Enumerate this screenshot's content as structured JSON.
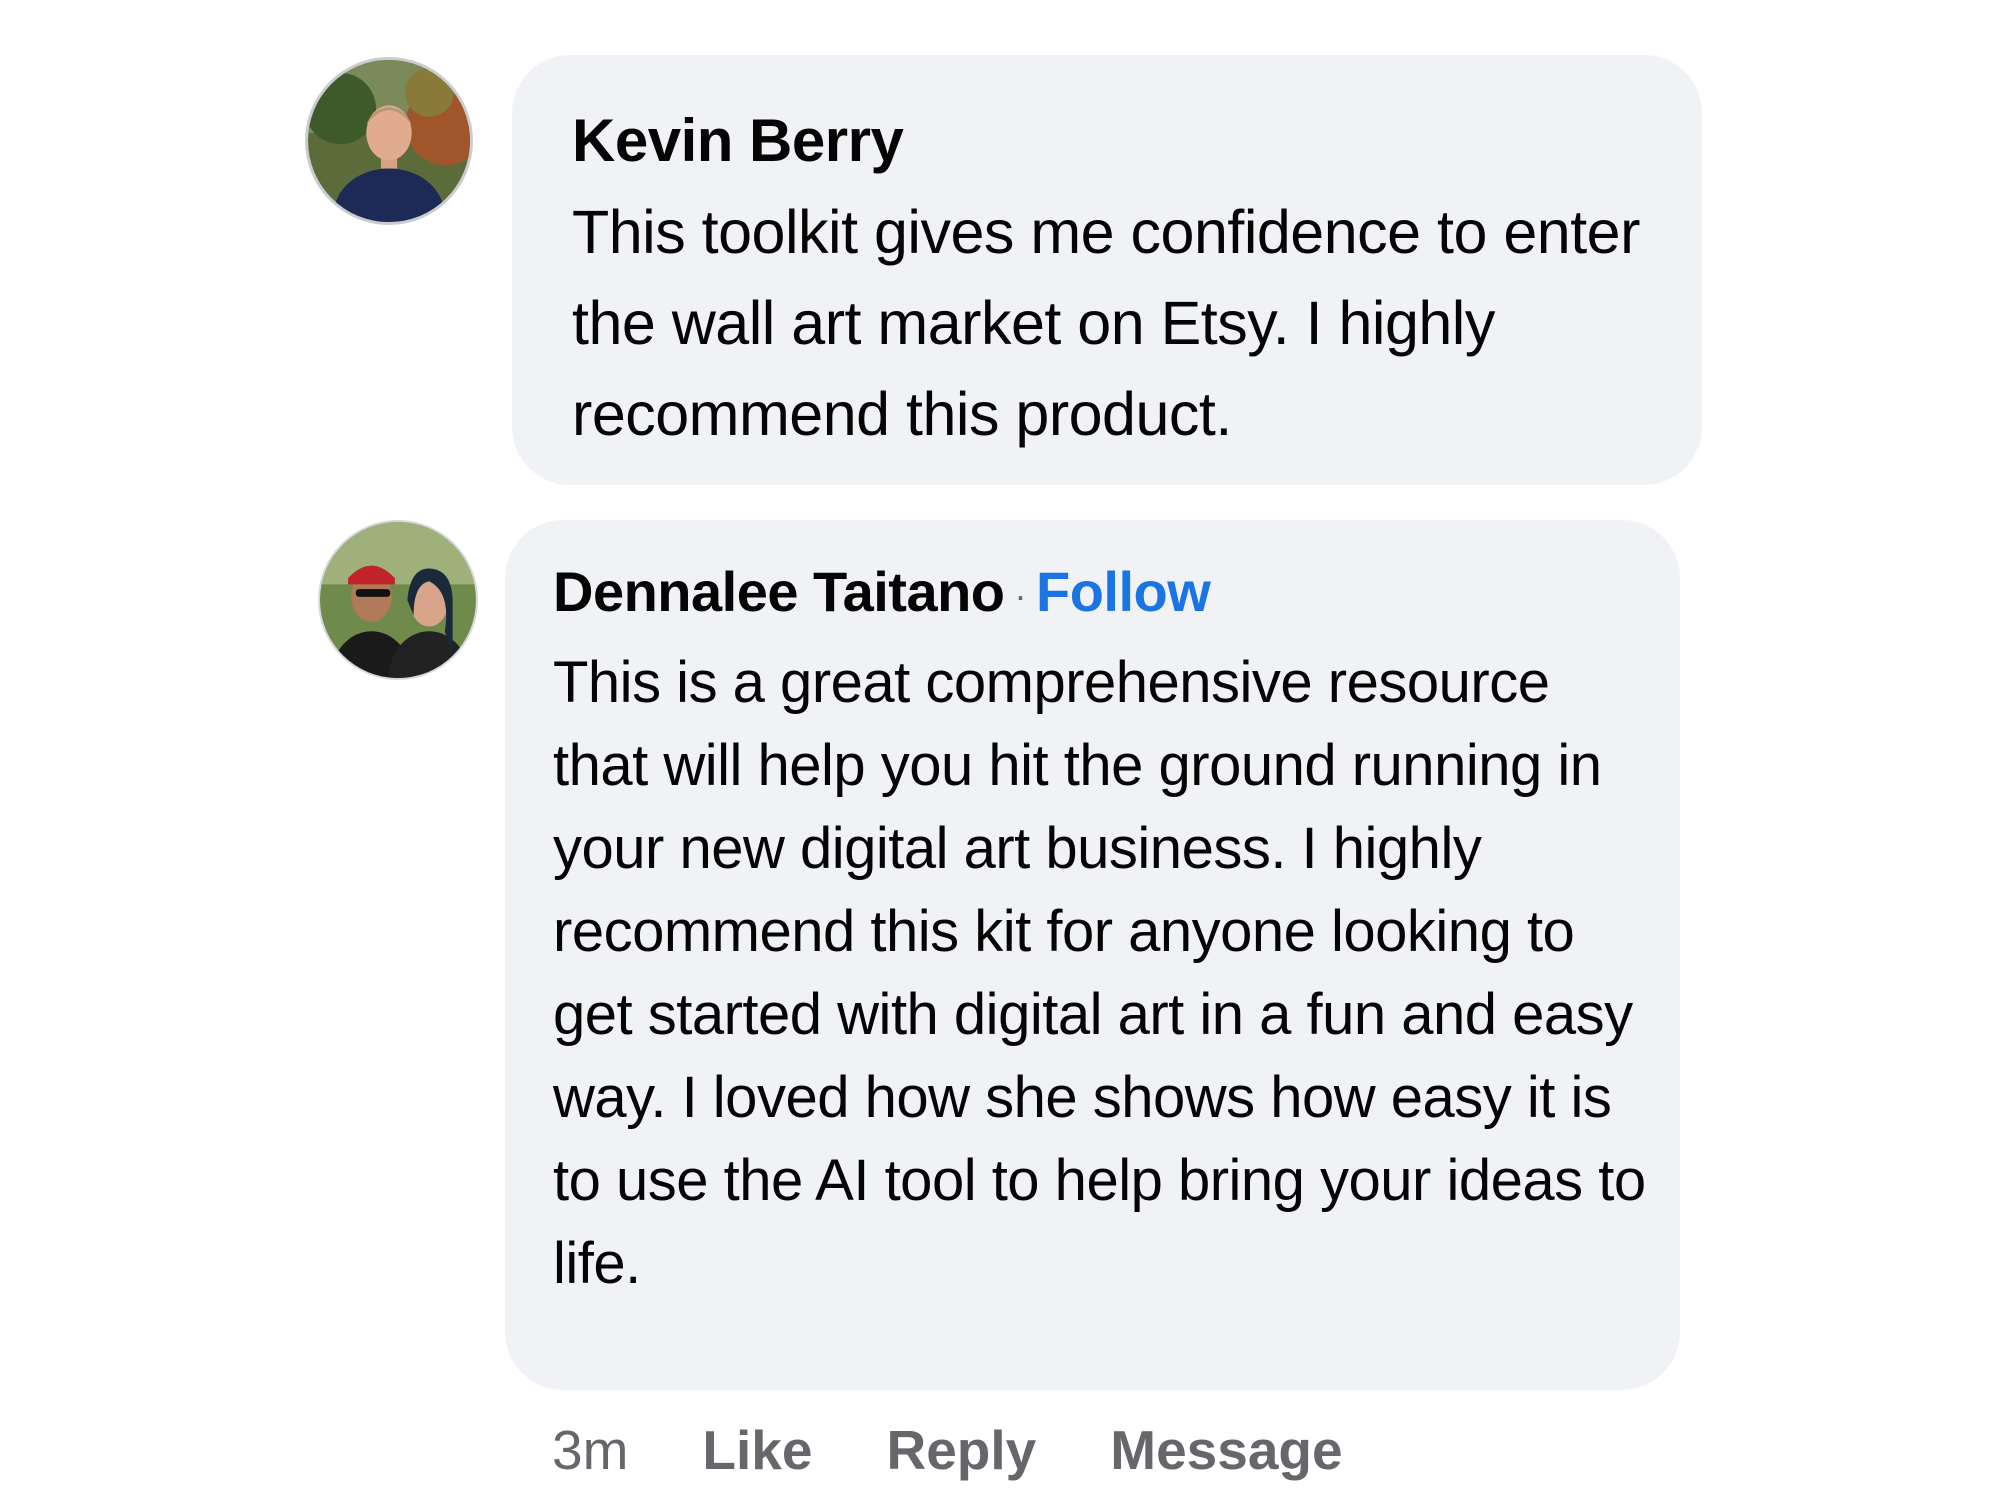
{
  "comments": [
    {
      "author": "Kevin Berry",
      "avatar_icon": "profile-photo-man-dark-shirt",
      "text": "This toolkit gives me confidence to enter the wall art market on Etsy. I highly recommend this product."
    },
    {
      "author": "Dennalee Taitano",
      "separator": "·",
      "follow_label": "Follow",
      "avatar_icon": "profile-photo-couple",
      "text": "This is a great comprehensive resource that will help you hit the ground running in your new digital art business. I highly recommend this kit for anyone looking to get started with digital art in a fun and easy way. I loved how she shows how easy it is to use the AI tool to help bring your ideas to life."
    }
  ],
  "actions": {
    "timestamp": "3m",
    "like_label": "Like",
    "reply_label": "Reply",
    "message_label": "Message"
  },
  "colors": {
    "bubble_bg": "#f0f2f5",
    "link_blue": "#1b74e4",
    "meta_gray": "#65676b",
    "text": "#050505"
  }
}
